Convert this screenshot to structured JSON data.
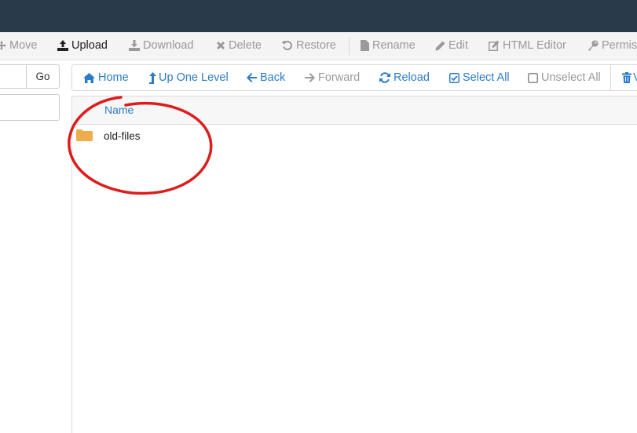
{
  "toolbar": {
    "items": [
      {
        "label": "Move",
        "icon": "move-icon"
      },
      {
        "label": "Upload",
        "icon": "upload-icon"
      },
      {
        "label": "Download",
        "icon": "download-icon"
      },
      {
        "label": "Delete",
        "icon": "delete-icon"
      },
      {
        "label": "Restore",
        "icon": "restore-icon"
      },
      {
        "label": "Rename",
        "icon": "file-icon"
      },
      {
        "label": "Edit",
        "icon": "pencil-icon"
      },
      {
        "label": "HTML Editor",
        "icon": "html-editor-icon"
      },
      {
        "label": "Permis",
        "icon": "key-icon"
      }
    ]
  },
  "path": {
    "go_label": "Go"
  },
  "nav": {
    "items": [
      {
        "label": "Home",
        "icon": "home-icon"
      },
      {
        "label": "Up One Level",
        "icon": "level-up-icon"
      },
      {
        "label": "Back",
        "icon": "arrow-left-icon"
      },
      {
        "label": "Forward",
        "icon": "arrow-right-icon"
      },
      {
        "label": "Reload",
        "icon": "refresh-icon"
      },
      {
        "label": "Select All",
        "icon": "checkbox-checked-icon"
      },
      {
        "label": "Unselect All",
        "icon": "checkbox-empty-icon"
      },
      {
        "label": "V",
        "icon": "trash-icon"
      }
    ]
  },
  "file_list": {
    "column_name": "Name",
    "rows": [
      {
        "name": "old-files",
        "type": "folder"
      }
    ]
  },
  "colors": {
    "topbar": "#293a4a",
    "link": "#2a7cc7",
    "folder": "#f0ad4e",
    "annotation": "#dd1c1c"
  }
}
